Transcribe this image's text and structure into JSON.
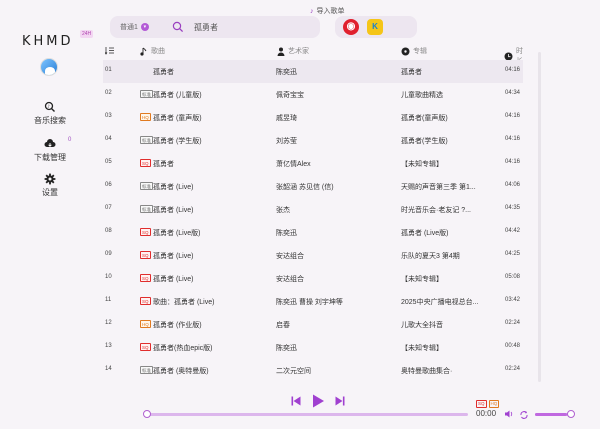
{
  "app": {
    "logo": "KHMD",
    "version_badge": "24H"
  },
  "sidebar": {
    "items": [
      {
        "label": "音乐搜索",
        "icon": "search-music-icon"
      },
      {
        "label": "下载管理",
        "icon": "cloud-download-icon"
      },
      {
        "label": "设置",
        "icon": "gear-icon"
      }
    ],
    "download_count": "0"
  },
  "topbar": {
    "import_label": "导入歌单",
    "source_select": "普通1",
    "search_value": "孤勇者",
    "platforms": [
      "netease-icon",
      "kuwo-icon"
    ]
  },
  "table": {
    "headers": {
      "title": "歌曲",
      "artist": "艺术家",
      "album": "专辑",
      "duration": "时长"
    },
    "rows": [
      {
        "num": "01",
        "quality": "",
        "title": "孤勇者",
        "artist": "陈奕迅",
        "album": "孤勇者",
        "duration": "04:16"
      },
      {
        "num": "02",
        "quality": "标准",
        "title": "孤勇者 (儿童版)",
        "artist": "佩奇宝宝",
        "album": "儿童歌曲精选",
        "duration": "04:34"
      },
      {
        "num": "03",
        "quality": "HQ",
        "title": "孤勇者 (童声版)",
        "artist": "戚昱琦",
        "album": "孤勇者(童声版)",
        "duration": "04:16"
      },
      {
        "num": "04",
        "quality": "标准",
        "title": "孤勇者 (学生版)",
        "artist": "刘苏莹",
        "album": "孤勇者(学生版)",
        "duration": "04:16"
      },
      {
        "num": "05",
        "quality": "SQ",
        "title": "孤勇者",
        "artist": "萧亿情Alex",
        "album": "【未知专辑】",
        "duration": "04:16"
      },
      {
        "num": "06",
        "quality": "标准",
        "title": "孤勇者 (Live)",
        "artist": "张韶涵 苏见信 (信)",
        "album": "天赐的声音第三季 第1...",
        "duration": "04:06"
      },
      {
        "num": "07",
        "quality": "标准",
        "title": "孤勇者 (Live)",
        "artist": "张杰",
        "album": "时光音乐会·老友记 ?...",
        "duration": "04:35"
      },
      {
        "num": "08",
        "quality": "SQ",
        "title": "孤勇者 (Live版)",
        "artist": "陈奕迅",
        "album": "孤勇者 (Live版)",
        "duration": "04:42"
      },
      {
        "num": "09",
        "quality": "SQ",
        "title": "孤勇者 (Live)",
        "artist": "安达组合",
        "album": "乐队的夏天3 第4期",
        "duration": "04:25"
      },
      {
        "num": "10",
        "quality": "SQ",
        "title": "孤勇者 (Live)",
        "artist": "安达组合",
        "album": "【未知专辑】",
        "duration": "05:08"
      },
      {
        "num": "11",
        "quality": "SQ",
        "title": "歌曲：孤勇者 (Live)",
        "artist": "陈奕迅 曹操 刘宇坤等",
        "album": "2025中央广播电视总台...",
        "duration": "03:42"
      },
      {
        "num": "12",
        "quality": "HQ",
        "title": "孤勇者 (作业版)",
        "artist": "启春",
        "album": "儿歌大全抖音",
        "duration": "02:24"
      },
      {
        "num": "13",
        "quality": "SQ",
        "title": "孤勇者(热血epic版)",
        "artist": "陈奕迅",
        "album": "【未知专辑】",
        "duration": "00:48"
      },
      {
        "num": "14",
        "quality": "标准",
        "title": "孤勇者 (奥特曼版)",
        "artist": "二次元空间",
        "album": "奥特曼歌曲集合·",
        "duration": "02:24"
      }
    ]
  },
  "player": {
    "time": "00:00",
    "quality_badges": [
      "SQ",
      "HQ"
    ],
    "progress": 0,
    "volume": 0.85
  },
  "colors": {
    "accent": "#b35ad6",
    "sq": "#e02d2d",
    "hq": "#e07a20"
  }
}
